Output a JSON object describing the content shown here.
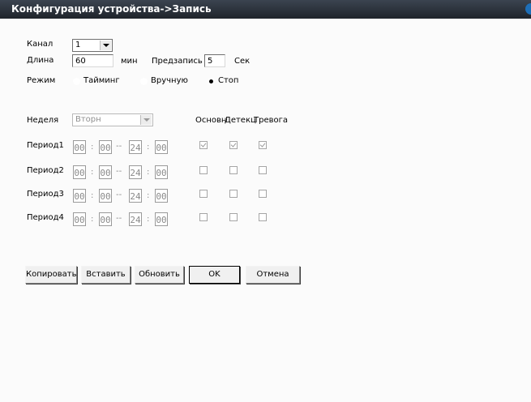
{
  "window": {
    "title": "Конфигурация устройства->Запись"
  },
  "channel": {
    "label": "Канал",
    "value": "1"
  },
  "length": {
    "label": "Длина",
    "value": "60",
    "unit": "мин"
  },
  "prerecord": {
    "label": "Предзапись",
    "value": "5",
    "unit": "Сек"
  },
  "mode": {
    "label": "Режим",
    "options": [
      "Тайминг",
      "Вручную",
      "Стоп"
    ],
    "selected": "Стоп"
  },
  "week": {
    "label": "Неделя",
    "value": "Вторн"
  },
  "columns": [
    "Основн",
    "Детекц",
    "Тревога"
  ],
  "periods": [
    {
      "label": "Период1",
      "start_h": "00",
      "start_m": "00",
      "end_h": "24",
      "end_m": "00",
      "basic": true,
      "detect": true,
      "alarm": true
    },
    {
      "label": "Период2",
      "start_h": "00",
      "start_m": "00",
      "end_h": "24",
      "end_m": "00",
      "basic": false,
      "detect": false,
      "alarm": false
    },
    {
      "label": "Период3",
      "start_h": "00",
      "start_m": "00",
      "end_h": "24",
      "end_m": "00",
      "basic": false,
      "detect": false,
      "alarm": false
    },
    {
      "label": "Период4",
      "start_h": "00",
      "start_m": "00",
      "end_h": "24",
      "end_m": "00",
      "basic": false,
      "detect": false,
      "alarm": false
    }
  ],
  "buttons": {
    "copy": "Копировать",
    "paste": "Вставить",
    "refresh": "Обновить",
    "ok": "OK",
    "cancel": "Отмена"
  }
}
